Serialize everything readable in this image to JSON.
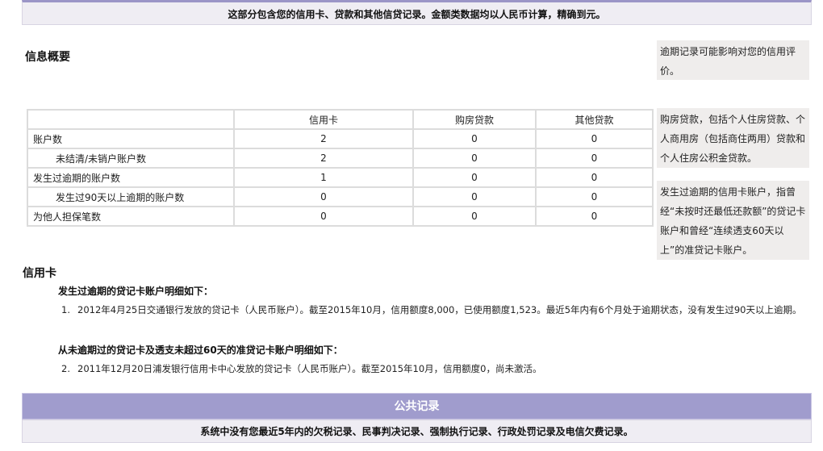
{
  "top_band": "这部分包含您的信用卡、贷款和其他信贷记录。金额类数据均以人民币计算，精确到元。",
  "summary": {
    "title": "信息概要",
    "columns": [
      "",
      "信用卡",
      "购房贷款",
      "其他贷款"
    ],
    "rows": [
      {
        "label": "账户数",
        "values": [
          "2",
          "0",
          "0"
        ]
      },
      {
        "label": "未结清/未销户账户数",
        "values": [
          "2",
          "0",
          "0"
        ]
      },
      {
        "label": "发生过逾期的账户数",
        "values": [
          "1",
          "0",
          "0"
        ]
      },
      {
        "label": "发生过90天以上逾期的账户数",
        "values": [
          "0",
          "0",
          "0"
        ]
      },
      {
        "label": "为他人担保笔数",
        "values": [
          "0",
          "0",
          "0"
        ]
      }
    ]
  },
  "notes": {
    "overdue": "逾期记录可能影响对您的信用评价。",
    "housing": "购房贷款，包括个人住房贷款、个人商用房（包括商住两用）贷款和个人住房公积金贷款。",
    "card_overdue": "发生过逾期的信用卡账户，指曾经“未按时还最低还款额”的贷记卡账户和曾经“连续透支60天以上”的准贷记卡账户。"
  },
  "credit_card": {
    "title": "信用卡",
    "overdue_heading": "发生过逾期的贷记卡账户明细如下：",
    "overdue_items": [
      {
        "idx": "1.",
        "text": "2012年4月25日交通银行发放的贷记卡（人民币账户）。截至2015年10月，信用额度8,000，已使用额度1,523。最近5年内有6个月处于逾期状态，没有发生过90天以上逾期。"
      }
    ],
    "normal_heading": "从未逾期过的贷记卡及透支未超过60天的准贷记卡账户明细如下：",
    "normal_items": [
      {
        "idx": "2.",
        "text": "2011年12月20日浦发银行信用卡中心发放的贷记卡（人民币账户）。截至2015年10月，信用额度0，尚未激活。"
      }
    ]
  },
  "public_records": {
    "title": "公共记录",
    "body": "系统中没有您最近5年内的欠税记录、民事判决记录、强制执行记录、行政处罚记录及电信欠费记录。"
  }
}
